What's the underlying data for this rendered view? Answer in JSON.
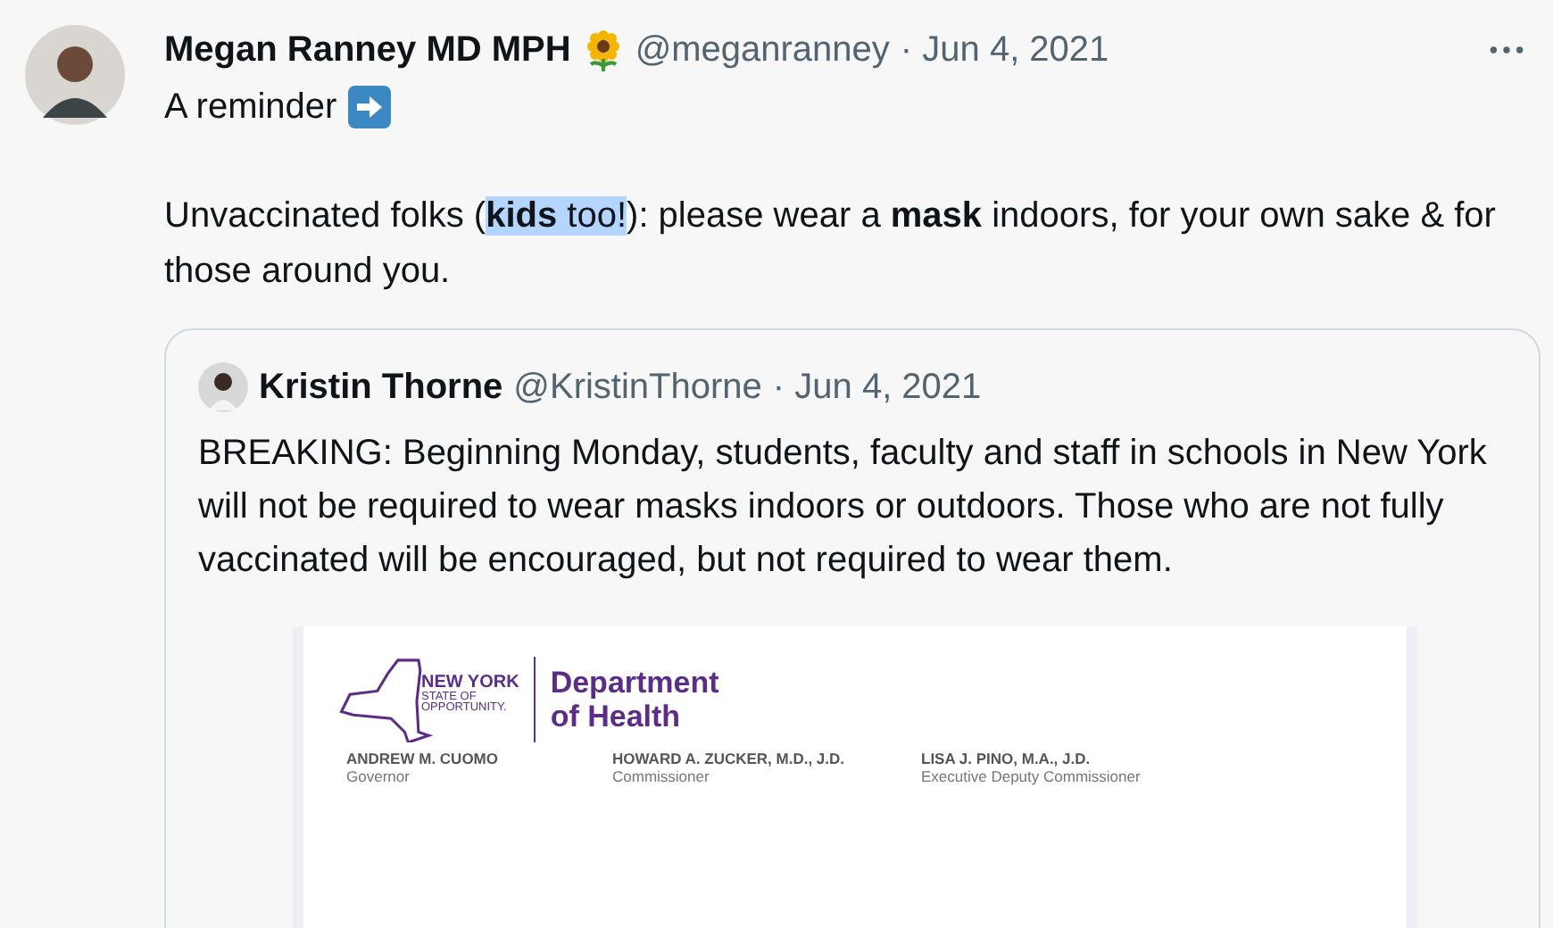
{
  "tweet": {
    "author": "Megan Ranney MD MPH",
    "handle": "@meganranney",
    "date": "· Jun 4, 2021",
    "first_line": "A reminder",
    "body": [
      {
        "text": "Unvaccinated folks (",
        "bold": false,
        "highlighted": false
      },
      {
        "text": "kids",
        "bold": true,
        "highlighted": true
      },
      {
        "text": " too!",
        "bold": false,
        "highlighted": true
      },
      {
        "text": "): please wear a ",
        "bold": false,
        "highlighted": false
      },
      {
        "text": "mask",
        "bold": true,
        "highlighted": false
      },
      {
        "text": " indoors, for your own sake & for those around you.",
        "bold": false,
        "highlighted": false
      }
    ]
  },
  "quoted_tweet": {
    "author": "Kristin Thorne",
    "handle": "@KristinThorne",
    "date": "· Jun 4, 2021",
    "text": "BREAKING: Beginning Monday, students, faculty and staff in schools in New York will not be required to wear masks indoors or outdoors. Those who are not fully vaccinated will be encouraged, but not required to wear them.",
    "document": {
      "logo_lines": [
        "NEW YORK",
        "STATE OF",
        "OPPORTUNITY."
      ],
      "department": [
        "Department",
        "of Health"
      ],
      "officials": [
        {
          "name": "ANDREW M. CUOMO",
          "title": "Governor"
        },
        {
          "name": "HOWARD A. ZUCKER, M.D., J.D.",
          "title": "Commissioner"
        },
        {
          "name": "LISA J. PINO, M.A., J.D.",
          "title": "Executive Deputy Commissioner"
        }
      ]
    }
  }
}
